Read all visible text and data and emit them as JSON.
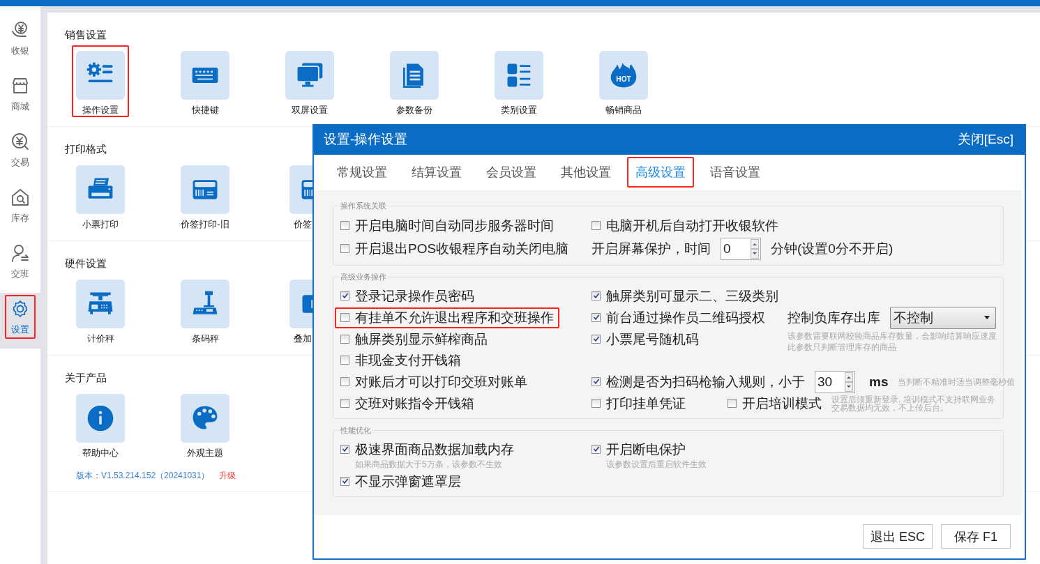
{
  "sidebar": {
    "items": [
      {
        "label": "收银",
        "selected": false,
        "highlighted": false
      },
      {
        "label": "商城",
        "selected": false,
        "highlighted": false
      },
      {
        "label": "交易",
        "selected": false,
        "highlighted": false
      },
      {
        "label": "库存",
        "selected": false,
        "highlighted": false
      },
      {
        "label": "交班",
        "selected": false,
        "highlighted": false
      },
      {
        "label": "设置",
        "selected": true,
        "highlighted": true
      }
    ]
  },
  "sections": [
    {
      "title": "销售设置",
      "tiles": [
        {
          "label": "操作设置",
          "highlighted": true,
          "cut": false
        },
        {
          "label": "快捷键",
          "highlighted": false,
          "cut": false
        },
        {
          "label": "双屏设置",
          "highlighted": false,
          "cut": false
        },
        {
          "label": "参数备份",
          "highlighted": false,
          "cut": false
        },
        {
          "label": "类别设置",
          "highlighted": false,
          "cut": false
        },
        {
          "label": "畅销商品",
          "highlighted": false,
          "cut": false,
          "icon_text": "HOT"
        }
      ]
    },
    {
      "title": "打印格式",
      "tiles": [
        {
          "label": "小票打印",
          "highlighted": false,
          "cut": false
        },
        {
          "label": "价签打印-旧",
          "highlighted": false,
          "cut": false
        },
        {
          "label": "价签",
          "highlighted": false,
          "cut": true
        }
      ]
    },
    {
      "title": "硬件设置",
      "tiles": [
        {
          "label": "计价秤",
          "highlighted": false,
          "cut": false
        },
        {
          "label": "条码秤",
          "highlighted": false,
          "cut": false
        },
        {
          "label": "叠加",
          "highlighted": false,
          "cut": true
        }
      ]
    },
    {
      "title": "关于产品",
      "tiles": [
        {
          "label": "帮助中心",
          "highlighted": false,
          "cut": false
        },
        {
          "label": "外观主题",
          "highlighted": false,
          "cut": false
        }
      ],
      "version": "版本：V1.53.214.152（20241031）",
      "upgrade_link": "升级"
    }
  ],
  "dialog": {
    "title": "设置-操作设置",
    "close_label": "关闭[Esc]",
    "tabs": [
      {
        "label": "常规设置",
        "selected": false,
        "highlighted": false
      },
      {
        "label": "结算设置",
        "selected": false,
        "highlighted": false
      },
      {
        "label": "会员设置",
        "selected": false,
        "highlighted": false
      },
      {
        "label": "其他设置",
        "selected": false,
        "highlighted": false
      },
      {
        "label": "高级设置",
        "selected": true,
        "highlighted": true
      },
      {
        "label": "语音设置",
        "selected": false,
        "highlighted": false
      }
    ],
    "groups": [
      {
        "title": "操作系统关联",
        "rows": [
          {
            "highlighted": false,
            "left": {
              "kind": "checkbox",
              "label": "开启电脑时间自动同步服务器时间",
              "checked": false
            },
            "right": [
              {
                "kind": "checkbox",
                "label": "电脑开机后自动打开收银软件",
                "checked": false
              }
            ]
          },
          {
            "highlighted": false,
            "left": {
              "kind": "checkbox",
              "label": "开启退出POS收银程序自动关闭电脑",
              "checked": false
            },
            "right": [
              {
                "kind": "text",
                "text": "开启屏幕保护，时间"
              },
              {
                "kind": "spinner",
                "value": "0"
              },
              {
                "kind": "text",
                "text": "分钟(设置0分不开启)"
              }
            ]
          }
        ]
      },
      {
        "title": "高级业务操作",
        "rows": [
          {
            "highlighted": false,
            "left": {
              "kind": "checkbox",
              "label": "登录记录操作员密码",
              "checked": true
            },
            "right": [
              {
                "kind": "checkbox",
                "label": "触屏类别可显示二、三级类别",
                "checked": true
              }
            ]
          },
          {
            "highlighted": true,
            "left": {
              "kind": "checkbox",
              "label": "有挂单不允许退出程序和交班操作",
              "checked": false
            },
            "right": [
              {
                "kind": "checkbox",
                "label": "前台通过操作员二维码授权",
                "checked": true
              },
              {
                "kind": "select",
                "label": "控制负库存出库",
                "value": "不控制",
                "hint_lines": [
                  "该参数需要联网校验商品库存数量，会影响结算响应速度",
                  "此参数只判断管理库存的商品"
                ]
              }
            ]
          },
          {
            "highlighted": false,
            "left": {
              "kind": "checkbox",
              "label": "触屏类别显示鲜榨商品",
              "checked": false
            },
            "right": [
              {
                "kind": "checkbox",
                "label": "小票尾号随机码",
                "checked": true
              }
            ]
          },
          {
            "highlighted": false,
            "left": {
              "kind": "checkbox",
              "label": "非现金支付开钱箱",
              "checked": false
            },
            "right": []
          },
          {
            "highlighted": false,
            "left": {
              "kind": "checkbox",
              "label": "对账后才可以打印交班对账单",
              "checked": false
            },
            "right": [
              {
                "kind": "checkbox",
                "label": "检测是否为扫码枪输入规则，小于",
                "checked": true
              },
              {
                "kind": "spinner",
                "value": "30"
              },
              {
                "kind": "unit",
                "text": "ms"
              },
              {
                "kind": "hint",
                "lines": [
                  "当判断不精准时适当调整毫秒值"
                ]
              }
            ]
          },
          {
            "highlighted": false,
            "left": {
              "kind": "checkbox",
              "label": "交班对账指令开钱箱",
              "checked": false
            },
            "right": [
              {
                "kind": "checkbox",
                "label": "打印挂单凭证",
                "checked": false
              },
              {
                "kind": "checkbox",
                "label": "开启培训模式",
                "checked": false
              },
              {
                "kind": "hint",
                "lines": [
                  "设置后须重新登录. 培训模式不支持联网业务",
                  "交易数据均无效，不上传后台。"
                ]
              }
            ]
          }
        ]
      },
      {
        "title": "性能优化",
        "rows": [
          {
            "highlighted": false,
            "left": {
              "kind": "checkbox",
              "label": "极速界面商品数据加载内存",
              "checked": true,
              "hint": "如果商品数据大于5万条，该参数不生效"
            },
            "right": [
              {
                "kind": "checkbox",
                "label": "开启断电保护",
                "checked": true,
                "hint": "该参数设置后重启软件生效"
              }
            ]
          },
          {
            "highlighted": false,
            "left": {
              "kind": "checkbox",
              "label": "不显示弹窗遮罩层",
              "checked": true
            },
            "right": []
          }
        ]
      }
    ],
    "buttons": [
      "退出 ESC",
      "保存 F1"
    ]
  }
}
